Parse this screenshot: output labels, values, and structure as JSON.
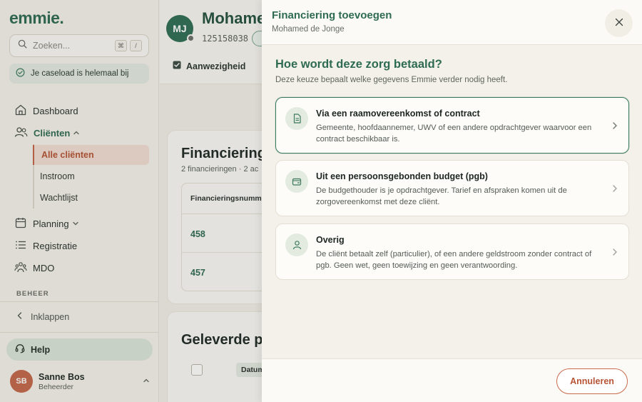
{
  "app": {
    "logo": "emmie."
  },
  "sidebar": {
    "search_placeholder": "Zoeken...",
    "shortcut_keys": [
      "⌘",
      "/"
    ],
    "caseload_status": "Je caseload is helemaal bij",
    "nav": {
      "dashboard": "Dashboard",
      "clients": "Cliënten",
      "clients_sub": [
        "Alle cliënten",
        "Instroom",
        "Wachtlijst"
      ],
      "planning": "Planning",
      "registratie": "Registratie",
      "mdo": "MDO"
    },
    "section_beheer": "BEHEER",
    "collapse_label": "Inklappen",
    "help_label": "Help",
    "user": {
      "initials": "SB",
      "name": "Sanne Bos",
      "role": "Beheerder"
    }
  },
  "client": {
    "initials": "MJ",
    "name": "Mohame",
    "id": "125158038",
    "tab_attendance": "Aanwezigheid"
  },
  "financing_card": {
    "title": "Financiering",
    "subtitle": "2 financieringen · 2 ac",
    "column_header": "Financieringsnumme",
    "rows": [
      "458",
      "457"
    ]
  },
  "delivered_card": {
    "title": "Geleverde p",
    "column_date": "Datum"
  },
  "drawer": {
    "title": "Financiering toevoegen",
    "subtitle": "Mohamed de Jonge",
    "question": "Hoe wordt deze zorg betaald?",
    "question_sub": "Deze keuze bepaalt welke gegevens Emmie verder nodig heeft.",
    "options": [
      {
        "title": "Via een raamovereenkomst of contract",
        "description": "Gemeente, hoofdaannemer, UWV of een andere opdrachtgever waarvoor een contract beschikbaar is.",
        "icon": "document-icon"
      },
      {
        "title": "Uit een persoonsgebonden budget (pgb)",
        "description": "De budgethouder is je opdrachtgever. Tarief en afspraken komen uit de zorgovereenkomst met deze cliënt.",
        "icon": "wallet-icon"
      },
      {
        "title": "Overig",
        "description": "De cliënt betaalt zelf (particulier), of een andere geldstroom zonder contract of pgb. Geen wet, geen toewijzing en geen verantwoording.",
        "icon": "person-icon"
      }
    ],
    "cancel_label": "Annuleren"
  },
  "colors": {
    "brand_green": "#2e6b52",
    "accent_terracotta": "#c46445",
    "background": "#f4f1ea"
  }
}
